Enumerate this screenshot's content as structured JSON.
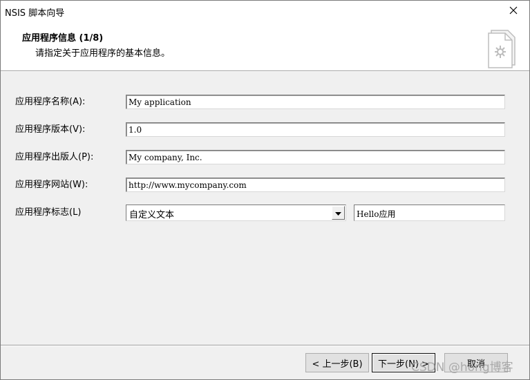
{
  "window": {
    "title": "NSIS 脚本向导",
    "close_glyph": "✕"
  },
  "header": {
    "title": "应用程序信息 (1/8)",
    "subtitle": "请指定关于应用程序的基本信息。",
    "icon": "document-gear-icon"
  },
  "form": {
    "app_name": {
      "label": "应用程序名称(A):",
      "value": "My application"
    },
    "app_version": {
      "label": "应用程序版本(V):",
      "value": "1.0"
    },
    "app_publisher": {
      "label": "应用程序出版人(P):",
      "value": "My company, Inc."
    },
    "app_website": {
      "label": "应用程序网站(W):",
      "value": "http://www.mycompany.com"
    },
    "app_logo": {
      "label": "应用程序标志(L)",
      "select_value": "自定义文本",
      "text_value": "Hello应用"
    }
  },
  "footer": {
    "back_label": "< 上一步(B)",
    "next_label": "下一步(N) >",
    "cancel_label": "取消"
  },
  "watermark": "CSDN @hong博客"
}
